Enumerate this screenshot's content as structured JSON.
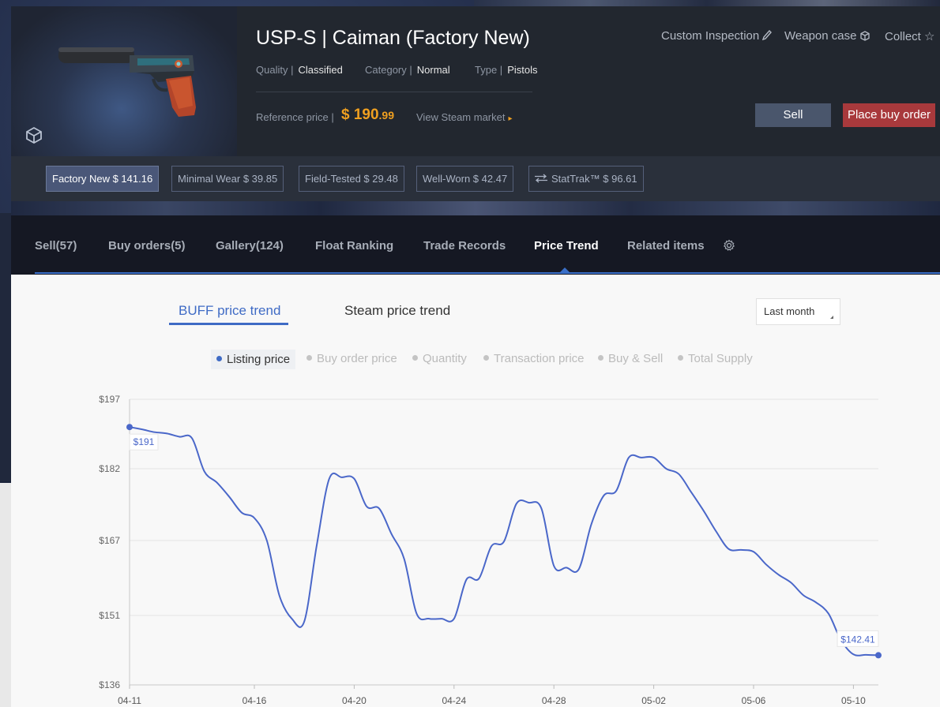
{
  "item": {
    "title": "USP-S | Caiman (Factory New)",
    "quality_label": "Quality |",
    "quality_value": "Classified",
    "category_label": "Category |",
    "category_value": "Normal",
    "type_label": "Type |",
    "type_value": "Pistols",
    "reference_label": "Reference price |",
    "reference_price_main": "$ 190",
    "reference_price_cents": ".99",
    "steam_link": "View Steam market"
  },
  "tools": {
    "custom_inspection": "Custom Inspection",
    "weapon_case": "Weapon case",
    "collect": "Collect"
  },
  "actions": {
    "sell": "Sell",
    "buy_order": "Place buy order"
  },
  "wears": [
    {
      "label": "Factory New $ 141.16",
      "active": true
    },
    {
      "label": "Minimal Wear $ 39.85",
      "active": false
    },
    {
      "label": "Field-Tested $ 29.48",
      "active": false
    },
    {
      "label": "Well-Worn $ 42.47",
      "active": false
    },
    {
      "label": "StatTrak™ $ 96.61",
      "active": false
    }
  ],
  "tabs": [
    {
      "label": "Sell(57)"
    },
    {
      "label": "Buy orders(5)"
    },
    {
      "label": "Gallery(124)"
    },
    {
      "label": "Float Ranking"
    },
    {
      "label": "Trade Records"
    },
    {
      "label": "Price Trend",
      "active": true
    },
    {
      "label": "Related items"
    }
  ],
  "subtabs": {
    "buff": "BUFF price trend",
    "steam": "Steam price trend",
    "period": "Last month"
  },
  "legend": [
    {
      "label": "Listing price",
      "active": true
    },
    {
      "label": "Buy order price",
      "active": false
    },
    {
      "label": "Quantity",
      "active": false
    },
    {
      "label": "Transaction price",
      "active": false
    },
    {
      "label": "Buy & Sell",
      "active": false
    },
    {
      "label": "Total Supply",
      "active": false
    }
  ],
  "colors": {
    "accent": "#3f6bc5",
    "line": "#4a67c9",
    "price": "#f0a020",
    "buy_button": "#a8393c",
    "sell_button": "#4a566c"
  },
  "chart_data": {
    "type": "line",
    "xlabel": "",
    "ylabel": "",
    "x_ticks": [
      "04-11",
      "04-16",
      "04-20",
      "04-24",
      "04-28",
      "05-02",
      "05-06",
      "05-10"
    ],
    "y_ticks": [
      "$197",
      "$182",
      "$167",
      "$151",
      "$136"
    ],
    "ylim": [
      136,
      197
    ],
    "grid": true,
    "series": [
      {
        "values": [
          [
            "04-11",
            191.0
          ],
          [
            "04-11.5",
            190.5
          ],
          [
            "04-12",
            189.9
          ],
          [
            "04-12.5",
            189.6
          ],
          [
            "04-13",
            188.9
          ],
          [
            "04-13.5",
            188.6
          ],
          [
            "04-14",
            181.4
          ],
          [
            "04-14.5",
            179.1
          ],
          [
            "04-15",
            176.1
          ],
          [
            "04-15.5",
            172.8
          ],
          [
            "04-16",
            171.7
          ],
          [
            "04-16.5",
            167.0
          ],
          [
            "04-17",
            155.3
          ],
          [
            "04-17.5",
            150.3
          ],
          [
            "04-18",
            149.7
          ],
          [
            "04-18.5",
            166.0
          ],
          [
            "04-19",
            179.9
          ],
          [
            "04-19.5",
            180.2
          ],
          [
            "04-20",
            179.9
          ],
          [
            "04-20.5",
            174.1
          ],
          [
            "04-21",
            173.7
          ],
          [
            "04-21.5",
            168.3
          ],
          [
            "04-22",
            163.1
          ],
          [
            "04-22.5",
            151.4
          ],
          [
            "04-23",
            150.3
          ],
          [
            "04-23.5",
            150.3
          ],
          [
            "04-24",
            150.3
          ],
          [
            "04-24.5",
            158.7
          ],
          [
            "04-25",
            158.9
          ],
          [
            "04-25.5",
            165.8
          ],
          [
            "04-26",
            166.8
          ],
          [
            "04-26.5",
            174.7
          ],
          [
            "04-27",
            174.9
          ],
          [
            "04-27.5",
            173.7
          ],
          [
            "04-28",
            161.6
          ],
          [
            "04-28.5",
            161.2
          ],
          [
            "04-29",
            160.9
          ],
          [
            "04-29.5",
            170.4
          ],
          [
            "04-30",
            176.4
          ],
          [
            "04-30.5",
            177.4
          ],
          [
            "05-01",
            184.4
          ],
          [
            "05-01.5",
            184.4
          ],
          [
            "05-02",
            184.4
          ],
          [
            "05-02.5",
            182.0
          ],
          [
            "05-03",
            180.9
          ],
          [
            "05-03.5",
            177.1
          ],
          [
            "05-04",
            173.2
          ],
          [
            "05-04.5",
            168.9
          ],
          [
            "05-05",
            165.2
          ],
          [
            "05-05.5",
            165.0
          ],
          [
            "05-06",
            164.6
          ],
          [
            "05-06.5",
            161.9
          ],
          [
            "05-07",
            159.7
          ],
          [
            "05-07.5",
            158.0
          ],
          [
            "05-08",
            155.3
          ],
          [
            "05-08.5",
            153.8
          ],
          [
            "05-09",
            151.4
          ],
          [
            "05-09.5",
            145.7
          ],
          [
            "05-10",
            142.6
          ],
          [
            "05-10.5",
            142.5
          ],
          [
            "05-11",
            142.41
          ]
        ]
      }
    ],
    "annotations": [
      "$191",
      "$142.41"
    ]
  }
}
